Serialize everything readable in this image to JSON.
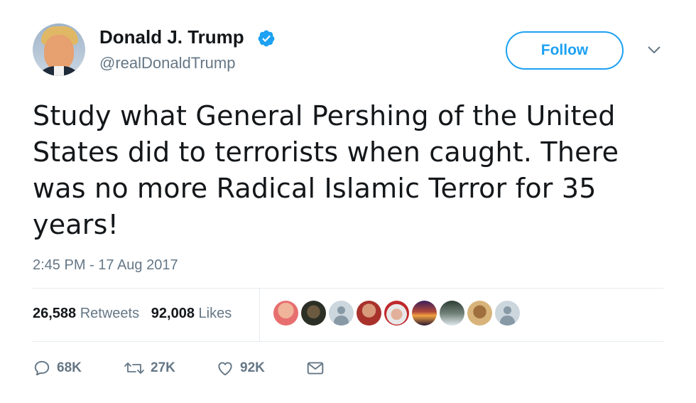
{
  "user": {
    "display_name": "Donald J. Trump",
    "handle": "@realDonaldTrump",
    "verified": true,
    "verified_color": "#1da1f2"
  },
  "follow_label": "Follow",
  "tweet_text": "Study what General Pershing of the United States did to terrorists when caught. There was no more Radical Islamic Terror for 35 years!",
  "timestamp": "2:45 PM - 17 Aug 2017",
  "stats": {
    "retweets_count": "26,588",
    "retweets_label": "Retweets",
    "likes_count": "92,008",
    "likes_label": "Likes"
  },
  "liker_avatars": [
    {
      "icon": "avatar-pink"
    },
    {
      "icon": "avatar-dark-beard"
    },
    {
      "icon": "avatar-default"
    },
    {
      "icon": "avatar-red"
    },
    {
      "icon": "avatar-cap"
    },
    {
      "icon": "avatar-sunset"
    },
    {
      "icon": "avatar-landscape"
    },
    {
      "icon": "avatar-tan"
    },
    {
      "icon": "avatar-default"
    }
  ],
  "actions": {
    "replies": "68K",
    "retweets": "27K",
    "likes": "92K"
  },
  "colors": {
    "accent": "#1da1f2",
    "secondary_text": "#657786",
    "divider": "#e6ecf0"
  }
}
